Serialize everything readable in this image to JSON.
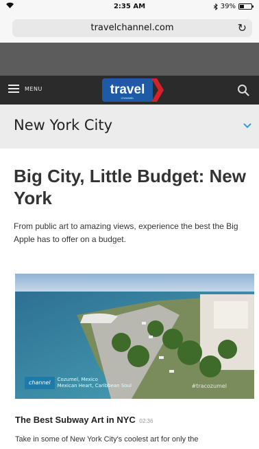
{
  "status_bar": {
    "time": "2:35 AM",
    "battery_text": "39%",
    "battery_level": 0.39
  },
  "browser": {
    "url": "travelchannel.com",
    "reload_icon": "reload-icon"
  },
  "nav": {
    "menu_label": "MENU",
    "logo_text": "travel",
    "logo_sub": "CHANNEL",
    "search_icon": "search-icon"
  },
  "city_selector": {
    "label": "New York City",
    "icon": "chevron-down-icon"
  },
  "article": {
    "headline": "Big City, Little Budget: New York",
    "deck": "From public art to amazing views, experience the best the Big Apple has to offer on a budget."
  },
  "hero": {
    "badge": "channel",
    "caption_line1": "Cozumel, Mexico",
    "caption_line2": "Mexican Heart, Caribbean Soul",
    "watermark": "#tracozumel"
  },
  "video": {
    "title": "The Best Subway Art in NYC",
    "duration": "02:36",
    "description": "Take in some of New York City's coolest art for only the"
  },
  "colors": {
    "logo_blue": "#1f5aa6",
    "logo_red": "#d72028",
    "accent_chevron": "#2a9fd6",
    "nav_bg": "#2b2b2b"
  }
}
